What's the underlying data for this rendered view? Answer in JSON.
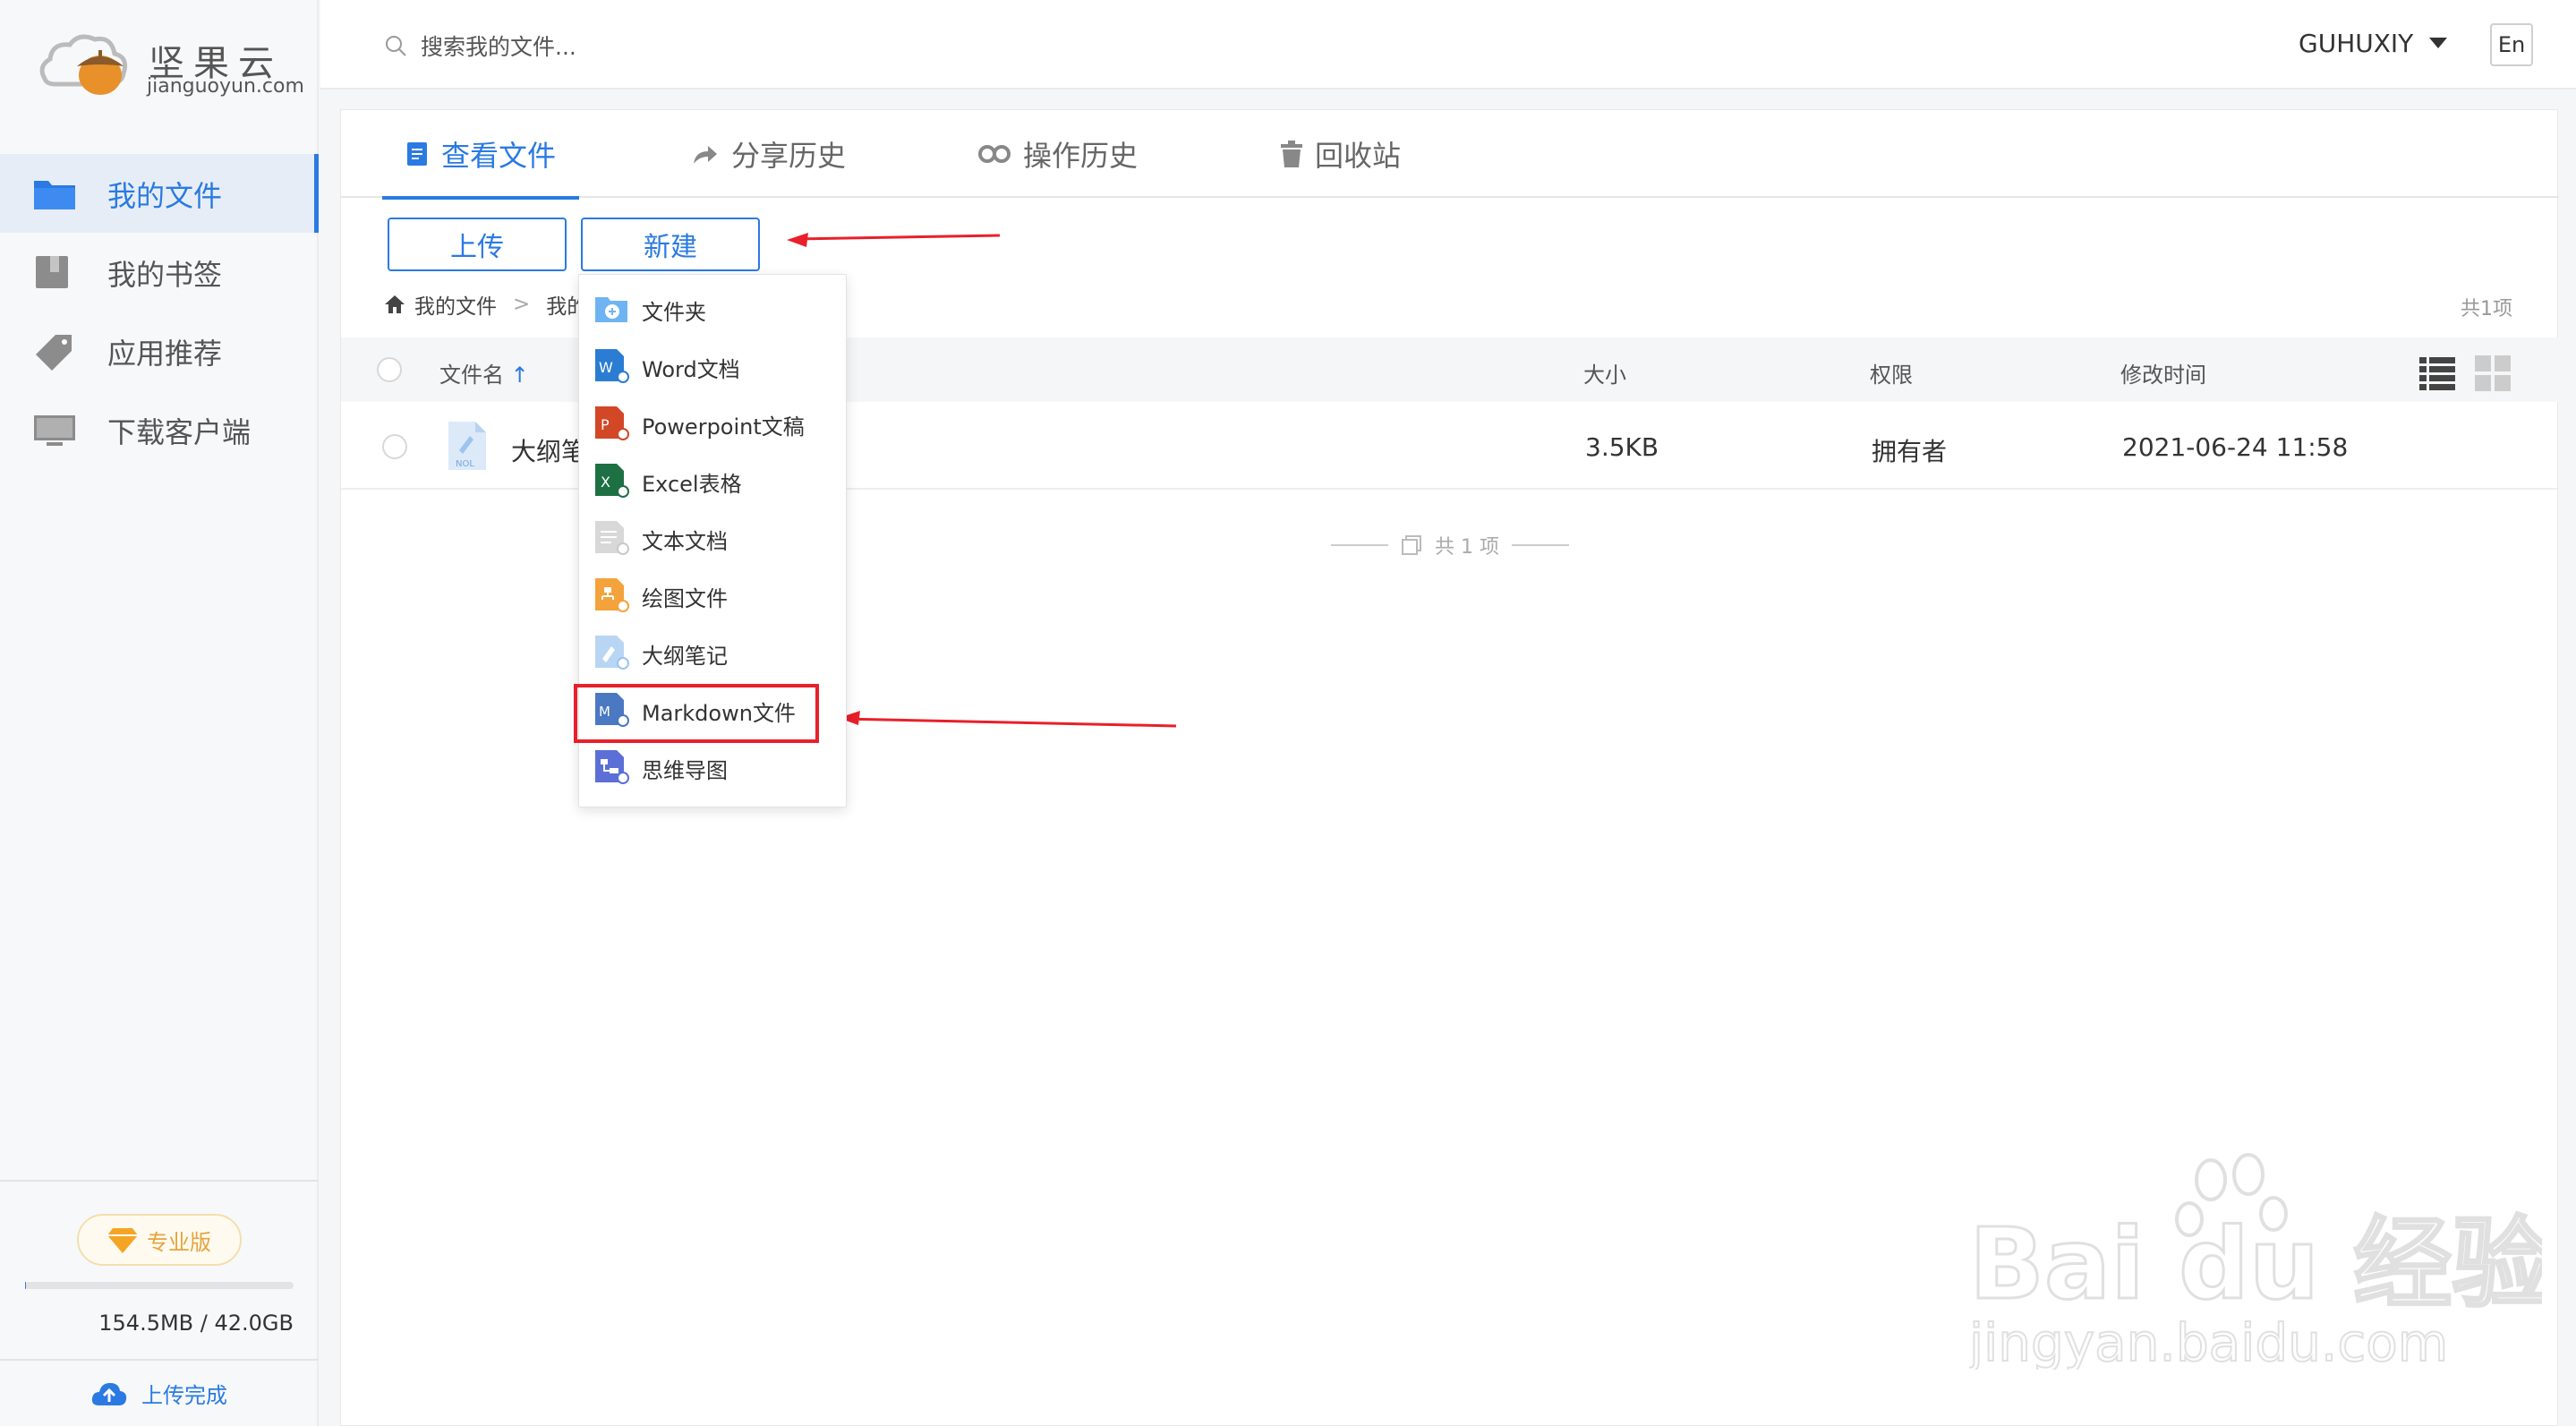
{
  "app": {
    "logo_name": "坚果云",
    "logo_domain": "jianguoyun.com"
  },
  "sidebar": {
    "items": [
      {
        "label": "我的文件",
        "icon": "folder-icon",
        "active": true
      },
      {
        "label": "我的书签",
        "icon": "book-icon",
        "active": false
      },
      {
        "label": "应用推荐",
        "icon": "tag-icon",
        "active": false
      },
      {
        "label": "下载客户端",
        "icon": "monitor-icon",
        "active": false
      }
    ],
    "pro_label": "专业版",
    "quota_used_fraction": 0.0036,
    "quota_text": "154.5MB / 42.0GB",
    "upload_status": "上传完成"
  },
  "topbar": {
    "search_placeholder": "搜索我的文件...",
    "username": "GUHUXIY",
    "lang_button": "En"
  },
  "tabs": [
    {
      "label": "查看文件",
      "icon": "document-icon",
      "active": true
    },
    {
      "label": "分享历史",
      "icon": "share-arrow-icon",
      "active": false
    },
    {
      "label": "操作历史",
      "icon": "history-icon",
      "active": false
    },
    {
      "label": "回收站",
      "icon": "trash-icon",
      "active": false
    }
  ],
  "toolbar": {
    "upload_label": "上传",
    "new_label": "新建"
  },
  "breadcrumb": {
    "root": "我的文件",
    "separator": ">",
    "current": "我的"
  },
  "total_count": "共1项",
  "table": {
    "columns": [
      "文件名",
      "大小",
      "权限",
      "修改时间"
    ],
    "sort_indicator": "↑",
    "rows": [
      {
        "name": "大纲笔",
        "size": "3.5KB",
        "permission": "拥有者",
        "modified": "2021-06-24 11:58"
      }
    ],
    "footer": "共 1 项"
  },
  "new_menu": {
    "items": [
      {
        "label": "文件夹",
        "icon": "folder-add-icon",
        "color": "#6fb4f2"
      },
      {
        "label": "Word文档",
        "icon": "word-icon",
        "color": "#2b7cd3"
      },
      {
        "label": "Powerpoint文稿",
        "icon": "powerpoint-icon",
        "color": "#d24726"
      },
      {
        "label": "Excel表格",
        "icon": "excel-icon",
        "color": "#1d7044"
      },
      {
        "label": "文本文档",
        "icon": "text-doc-icon",
        "color": "#c9c9c9"
      },
      {
        "label": "绘图文件",
        "icon": "drawing-icon",
        "color": "#f4a23c"
      },
      {
        "label": "大纲笔记",
        "icon": "outline-note-icon",
        "color": "#9bc4f0"
      },
      {
        "label": "Markdown文件",
        "icon": "markdown-icon",
        "color": "#4a78c2"
      },
      {
        "label": "思维导图",
        "icon": "mindmap-icon",
        "color": "#5b6fd6"
      }
    ],
    "highlighted": "Markdown文件"
  },
  "colors": {
    "accent": "#2a7ae2",
    "annotation": "#e8202a"
  },
  "watermark": {
    "brand": "Bai du 经验",
    "domain": "jingyan.baidu.com"
  }
}
